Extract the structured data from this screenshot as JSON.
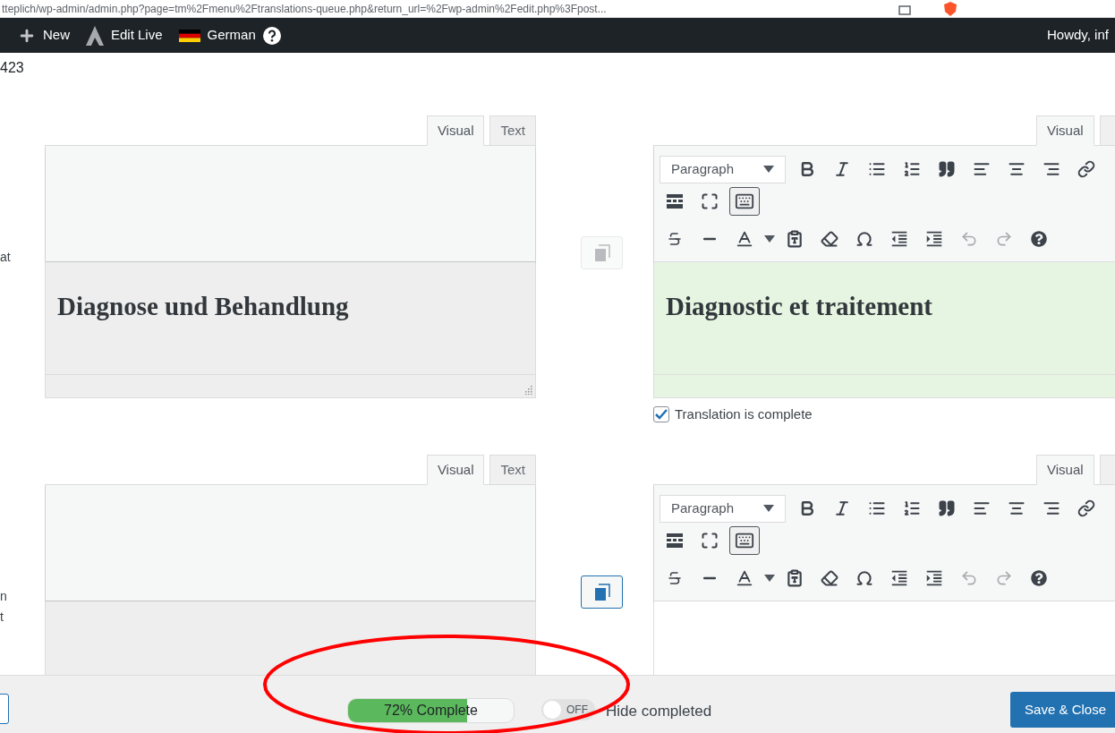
{
  "browser": {
    "url": "tteplich/wp-admin/admin.php?page=tm%2Fmenu%2Ftranslations-queue.php&return_url=%2Fwp-admin%2Fedit.php%3Fpost..."
  },
  "admin_bar": {
    "items": [
      {
        "kind": "new",
        "label": "New"
      },
      {
        "kind": "edit_live",
        "label": "Edit Live"
      },
      {
        "kind": "language",
        "label": "German"
      }
    ],
    "greeting": "Howdy, inf"
  },
  "job_id": "423",
  "fields": [
    {
      "label_fragments": [
        "at"
      ],
      "original": {
        "tabs": [
          {
            "label": "Visual",
            "selected": true
          },
          {
            "label": "Text",
            "selected": false
          }
        ],
        "content": "Diagnose und Behandlung"
      },
      "copy_active": false,
      "translation": {
        "tabs": [
          {
            "label": "Visual",
            "selected": true
          },
          {
            "selected": false
          }
        ],
        "format": "Paragraph",
        "content": "Diagnostic et traitement",
        "complete": true,
        "complete_label": "Translation is complete"
      }
    },
    {
      "label_fragments": [
        "n",
        "t"
      ],
      "original": {
        "tabs": [
          {
            "label": "Visual",
            "selected": true
          },
          {
            "label": "Text",
            "selected": false
          }
        ]
      },
      "copy_active": true,
      "translation": {
        "tabs": [
          {
            "label": "Visual",
            "selected": true
          },
          {
            "selected": false
          }
        ],
        "format": "Paragraph",
        "complete": false
      }
    }
  ],
  "footer": {
    "progress": {
      "level": 0.72,
      "label": "72% Complete"
    },
    "hide_completed": {
      "on": false,
      "state_label": "OFF",
      "label": "Hide completed"
    },
    "save_button": "Save & Close"
  }
}
